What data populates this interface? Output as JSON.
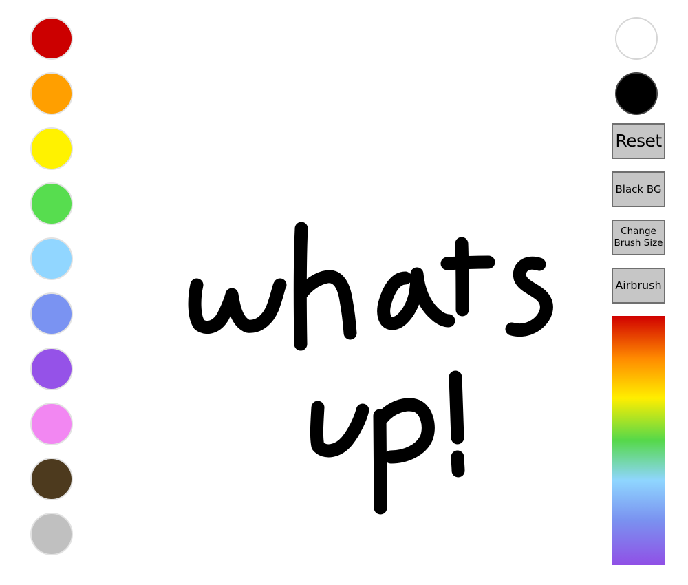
{
  "palette": {
    "colors": [
      {
        "name": "red",
        "hex": "#cc0000"
      },
      {
        "name": "orange",
        "hex": "#ff9f00"
      },
      {
        "name": "yellow",
        "hex": "#fff200"
      },
      {
        "name": "green",
        "hex": "#57dd4f"
      },
      {
        "name": "light-blue",
        "hex": "#91d6ff"
      },
      {
        "name": "periwinkle",
        "hex": "#7a93f2"
      },
      {
        "name": "purple",
        "hex": "#9552e8"
      },
      {
        "name": "pink",
        "hex": "#f287f2"
      },
      {
        "name": "brown",
        "hex": "#4d3a1e"
      },
      {
        "name": "gray",
        "hex": "#c0c0c0"
      }
    ]
  },
  "right_panel": {
    "white_swatch": {
      "hex": "#ffffff"
    },
    "black_swatch": {
      "hex": "#000000"
    },
    "reset_label": "Reset",
    "black_bg_label": "Black BG",
    "brush_size_label": "Change\nBrush Size",
    "airbrush_label": "Airbrush",
    "rainbow_picker": {
      "icon": "rainbow-gradient"
    }
  },
  "canvas": {
    "background": "#ffffff",
    "stroke_color": "#000000",
    "drawing_text": "whats up!"
  }
}
